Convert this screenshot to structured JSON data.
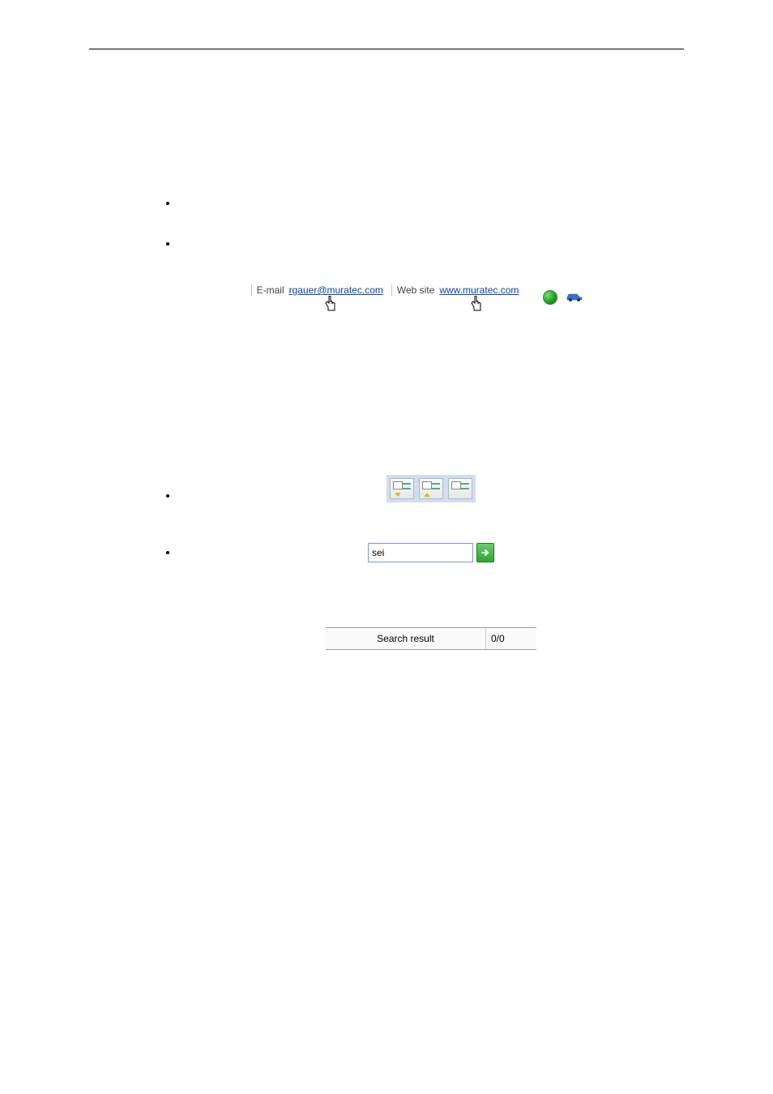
{
  "header": {
    "title": ""
  },
  "bullets_top": [
    "",
    ""
  ],
  "links_row": {
    "email_label": "E-mail",
    "email_value": "rgauer@muratec.com",
    "web_label": "Web site",
    "web_value": "www.muratec.com"
  },
  "bullets_mid": [
    "",
    ""
  ],
  "search": {
    "value": "sei"
  },
  "result_bar": {
    "label": "Search result",
    "count": "0/0"
  }
}
